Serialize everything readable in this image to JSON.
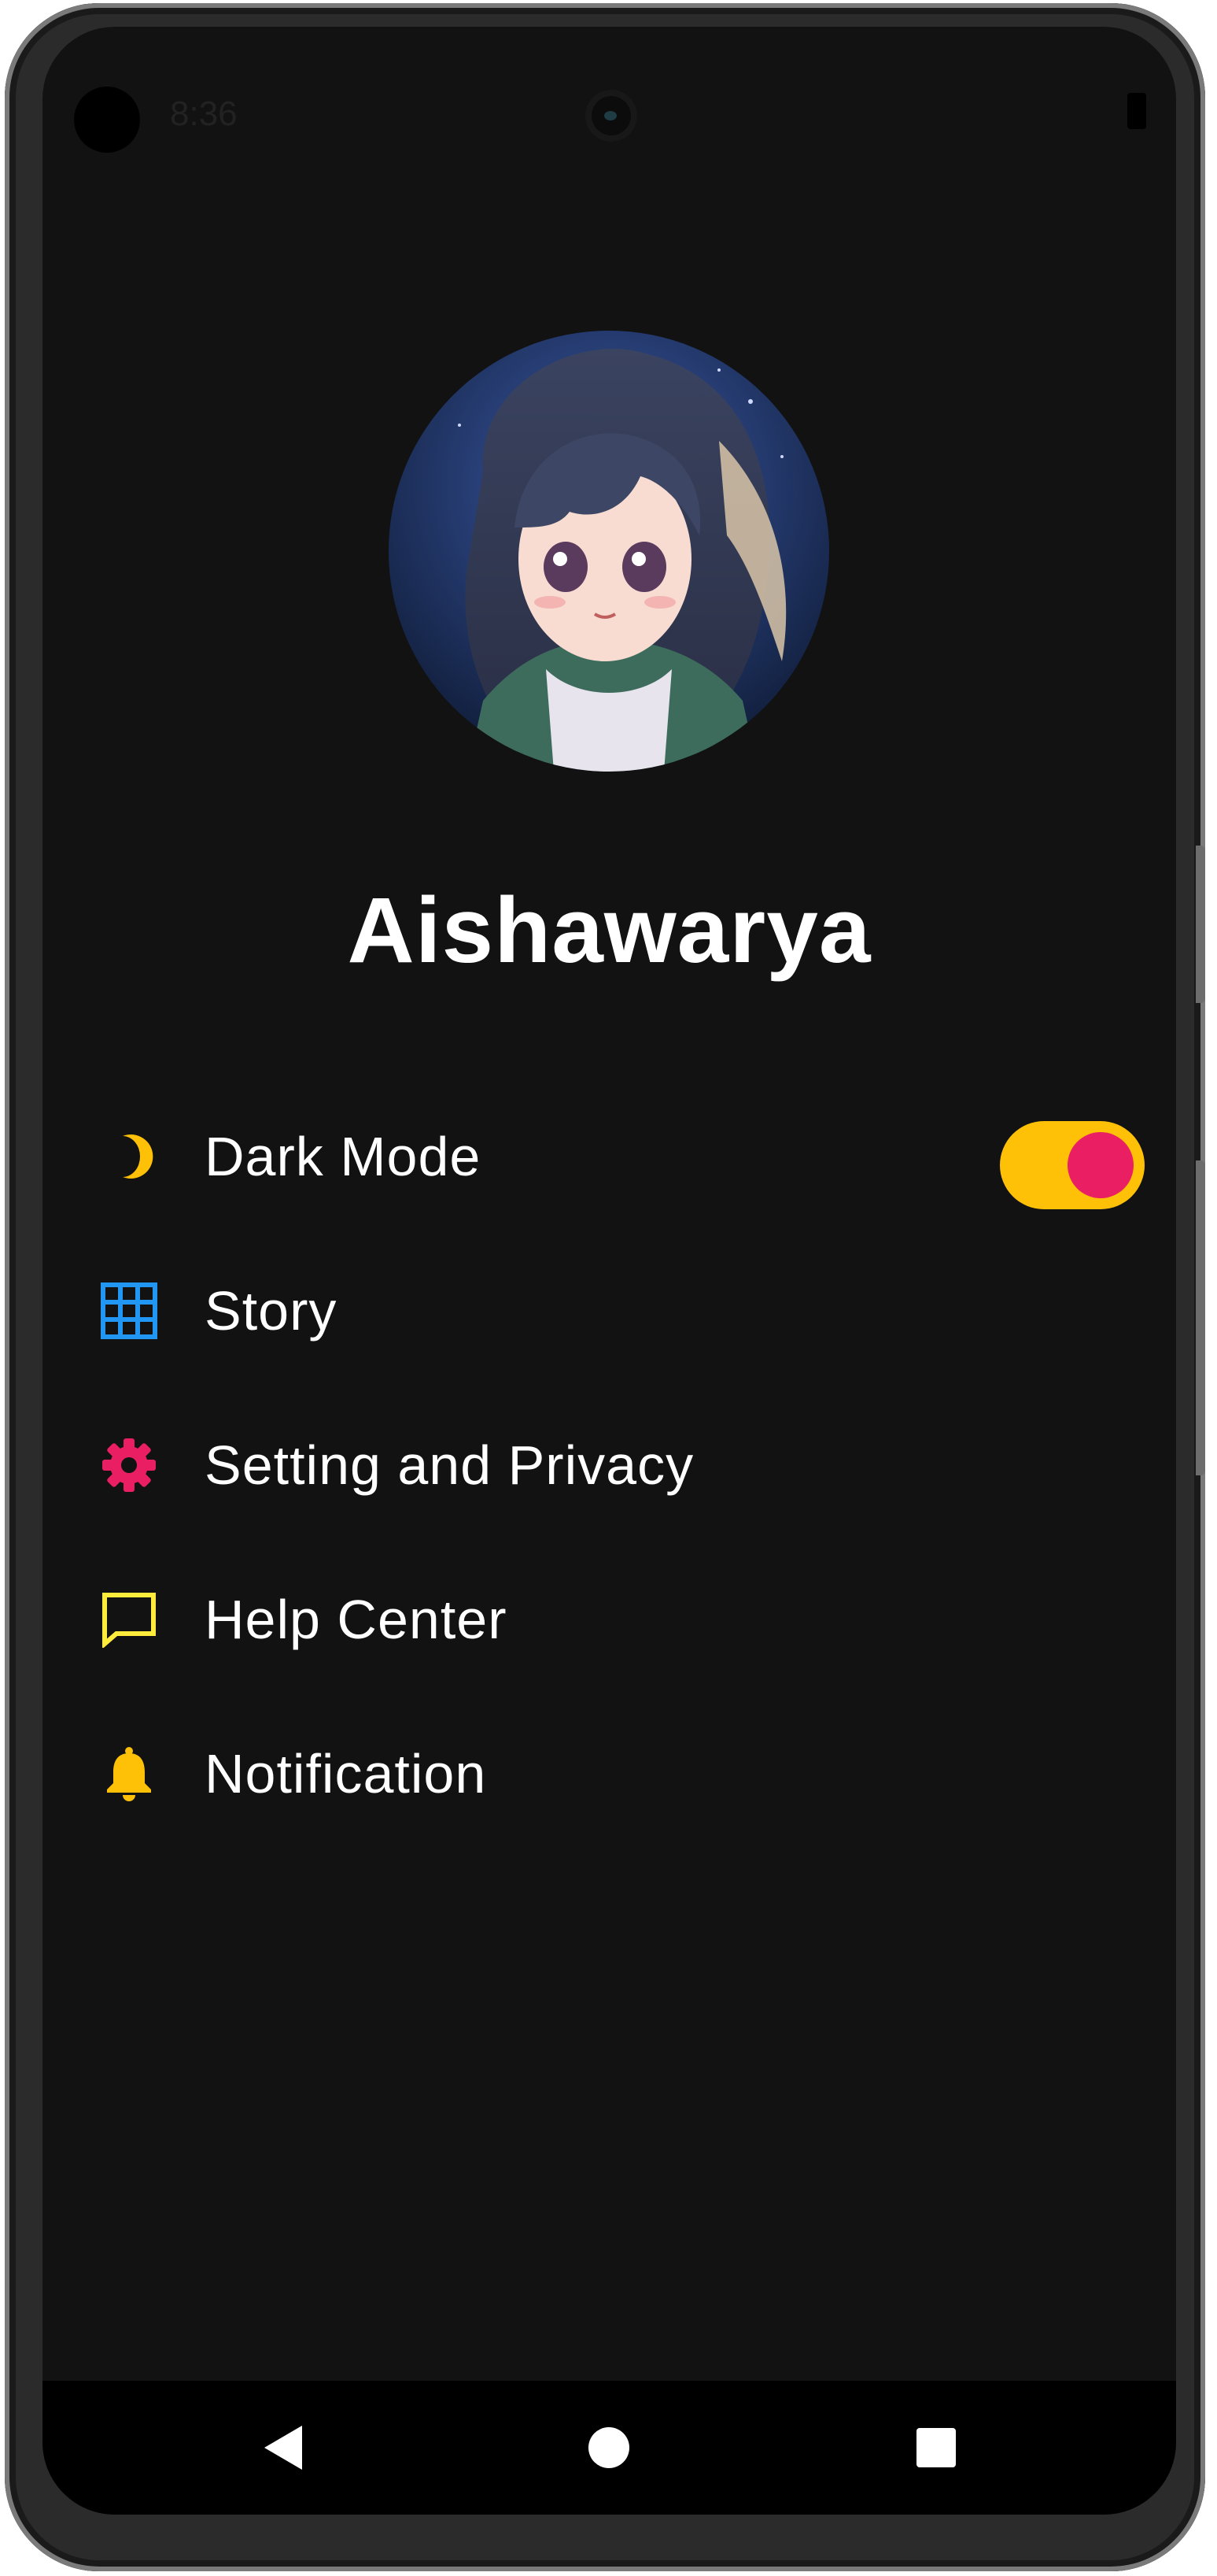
{
  "status_bar": {
    "time": "8:36"
  },
  "profile": {
    "name": "Aishawarya",
    "avatar_description_icon": "avatar-image"
  },
  "menu": {
    "items": [
      {
        "label": "Dark Mode",
        "icon": "moon-icon",
        "icon_color": "#FFC107",
        "toggle": true
      },
      {
        "label": "Story",
        "icon": "grid-icon",
        "icon_color": "#2196F3"
      },
      {
        "label": "Setting and Privacy",
        "icon": "gear-icon",
        "icon_color": "#E91E63"
      },
      {
        "label": "Help Center",
        "icon": "chat-bubble-icon",
        "icon_color": "#FFEB3B"
      },
      {
        "label": "Notification",
        "icon": "bell-icon",
        "icon_color": "#FFC107"
      }
    ],
    "dark_mode_enabled": true
  },
  "colors": {
    "background": "#121212",
    "toggle_track": "#FFC107",
    "toggle_knob": "#E91E63",
    "text": "#FFFFFF"
  },
  "nav": {
    "buttons": [
      "back-icon",
      "home-icon",
      "recents-icon"
    ]
  }
}
